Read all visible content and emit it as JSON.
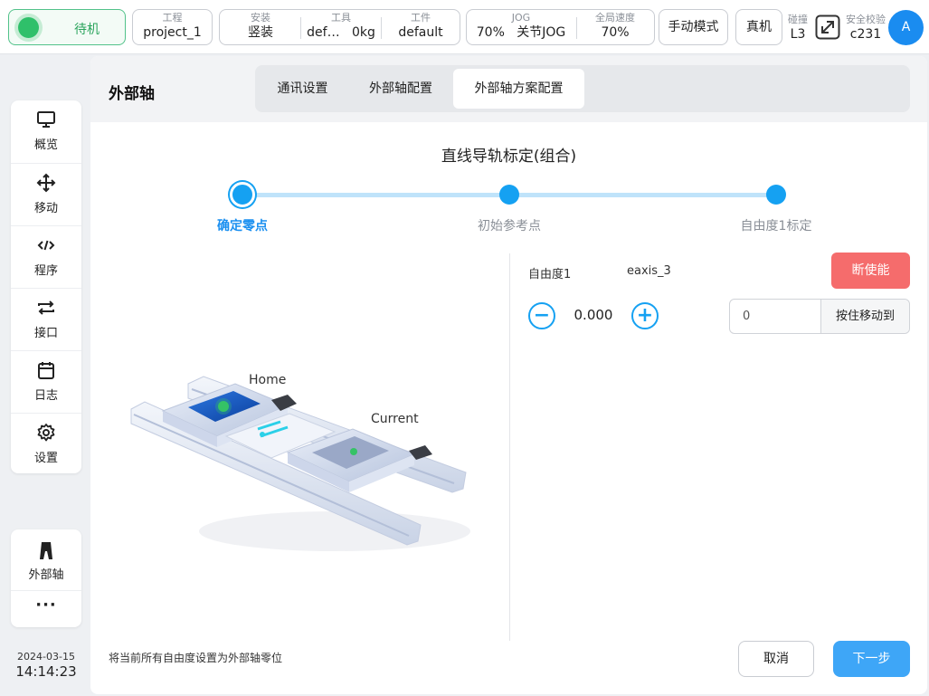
{
  "topbar": {
    "status": "待机",
    "project": {
      "label": "工程",
      "value": "project_1"
    },
    "install": {
      "label": "安装",
      "value": "竖装"
    },
    "tool": {
      "label": "工具",
      "name": "def…",
      "load": "0kg"
    },
    "workpiece": {
      "label": "工件",
      "value": "default"
    },
    "jog": {
      "label": "JOG",
      "speed": "70%",
      "mode": "关节JOG"
    },
    "global_speed": {
      "label": "全局速度",
      "value": "70%"
    },
    "manual_mode": "手动模式",
    "real_machine": "真机",
    "collision": {
      "label": "碰撞",
      "value": "L3"
    },
    "safety": {
      "label": "安全校验",
      "value": "c231"
    },
    "avatar": "A"
  },
  "sidebar": {
    "items": [
      {
        "label": "概览",
        "icon": "monitor-icon"
      },
      {
        "label": "移动",
        "icon": "move-arrows-icon"
      },
      {
        "label": "程序",
        "icon": "code-icon"
      },
      {
        "label": "接口",
        "icon": "exchange-icon"
      },
      {
        "label": "日志",
        "icon": "calendar-icon"
      },
      {
        "label": "设置",
        "icon": "gear-icon"
      }
    ],
    "external_axis": "外部轴",
    "more": "···",
    "date": "2024-03-15",
    "time": "14:14:23"
  },
  "panel": {
    "title": "外部轴",
    "tabs": [
      "通讯设置",
      "外部轴配置",
      "外部轴方案配置"
    ],
    "active_tab": 2,
    "wizard_title": "直线导轨标定(组合)",
    "steps": [
      "确定零点",
      "初始参考点",
      "自由度1标定"
    ],
    "current_step": 0,
    "illustration": {
      "home_label": "Home",
      "current_label": "Current"
    },
    "dof_label": "自由度1",
    "axis_name": "eaxis_3",
    "disable_button": "断使能",
    "dof_value": "0.000",
    "move_input_value": "0",
    "move_button": "按住移动到",
    "hint": "将当前所有自由度设置为外部轴零位",
    "cancel": "取消",
    "next": "下一步"
  },
  "colors": {
    "accent": "#15a1f2",
    "status_green": "#2fc06a",
    "danger": "#f56c6c",
    "primary_button": "#3ea6f7"
  }
}
